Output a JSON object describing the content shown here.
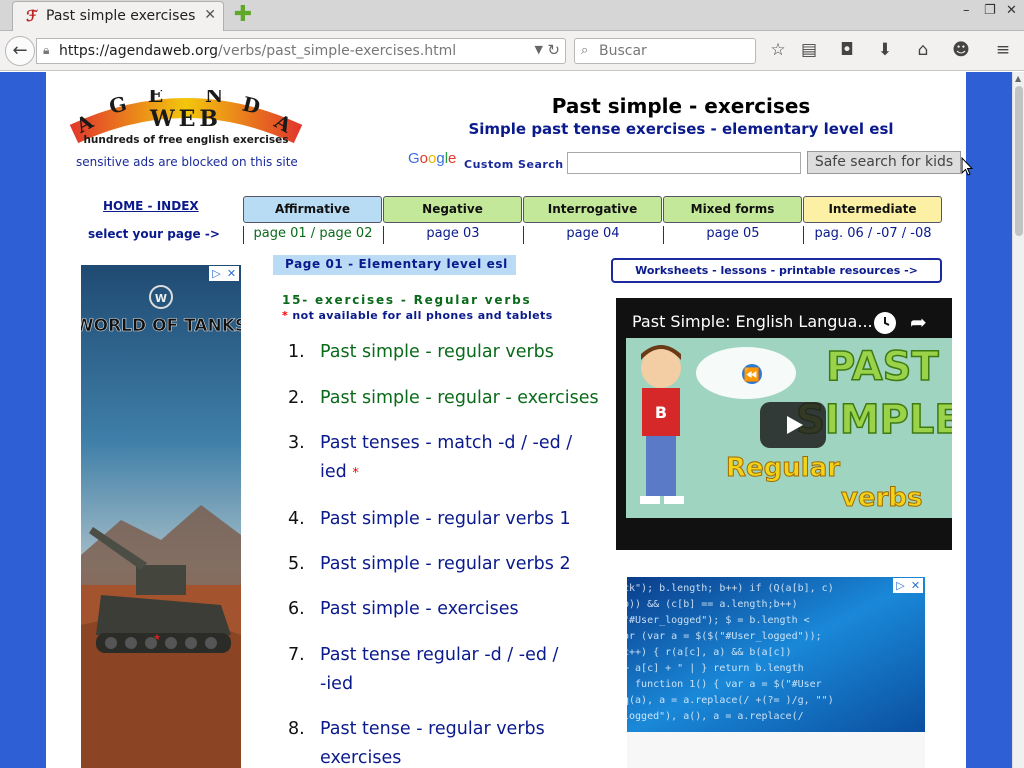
{
  "browser": {
    "tab_title": "Past simple exercises",
    "tab_close": "✕",
    "new_tab": "✚",
    "url_host": "https://agendaweb.org",
    "url_path": "/verbs/past_simple-exercises.html",
    "search_placeholder": "Buscar",
    "window_controls": [
      "–",
      "❐",
      "✕"
    ]
  },
  "logo": {
    "letters": "AGENDA",
    "word": "WEB",
    "tagline": "hundreds of free english exercises",
    "subtext": "sensitive ads are blocked on this site"
  },
  "header": {
    "title": "Past simple - exercises",
    "subtitle": "Simple past tense exercises - elementary level esl"
  },
  "custom_search": {
    "google_letters": [
      "G",
      "o",
      "o",
      "g",
      "l",
      "e"
    ],
    "label": "Custom Search",
    "button": "Safe search for kids"
  },
  "nav": {
    "home": "HOME - INDEX",
    "select": "select your page ->",
    "tabs": [
      {
        "label": "Affirmative",
        "color": "#b9dcf5"
      },
      {
        "label": "Negative",
        "color": "#c4e89a"
      },
      {
        "label": "Interrogative",
        "color": "#c4e89a"
      },
      {
        "label": "Mixed forms",
        "color": "#c4e89a"
      },
      {
        "label": "Intermediate",
        "color": "#fbf0a4"
      }
    ],
    "pages": [
      "page 01 / page 02",
      "page 03",
      "page 04",
      "page 05",
      "pag. 06 / -07 / -08"
    ]
  },
  "section": {
    "badge": "Page 01 - Elementary level esl",
    "count": "15- exercises - Regular verbs",
    "note_star": "*",
    "note": "not available for all phones and tablets"
  },
  "exercises": [
    {
      "num": "1.",
      "lines": [
        "Past simple - regular verbs"
      ],
      "star": "",
      "color": "#0a6a1a"
    },
    {
      "num": "2.",
      "lines": [
        "Past simple - regular - exercises"
      ],
      "star": "",
      "color": "#0a6a1a"
    },
    {
      "num": "3.",
      "lines": [
        "Past tenses - match -d / -ed /",
        "ied"
      ],
      "star": "*",
      "color": "#0a1a8c"
    },
    {
      "num": "4.",
      "lines": [
        "Past simple - regular verbs 1"
      ],
      "star": "",
      "color": "#0a1a8c"
    },
    {
      "num": "5.",
      "lines": [
        "Past simple - regular verbs 2"
      ],
      "star": "",
      "color": "#0a1a8c"
    },
    {
      "num": "6.",
      "lines": [
        "Past simple - exercises"
      ],
      "star": "",
      "color": "#0a1a8c"
    },
    {
      "num": "7.",
      "lines": [
        "Past tense regular -d / -ed /",
        "-ied"
      ],
      "star": "",
      "color": "#0a1a8c"
    },
    {
      "num": "8.",
      "lines": [
        "Past tense - regular verbs",
        "exercises"
      ],
      "star": "",
      "color": "#0a1a8c"
    }
  ],
  "worksheets": "Worksheets - lessons - printable resources ->",
  "video": {
    "title": "Past Simple: English Langua...",
    "word1": "PAST",
    "word2": "SIMPLE",
    "word3": "Regular",
    "word4": "verbs",
    "shirt_letter": "B"
  },
  "ads": {
    "left_brand": "WORLD OF TANKS",
    "close": "✕",
    "adchoice": "▷"
  }
}
